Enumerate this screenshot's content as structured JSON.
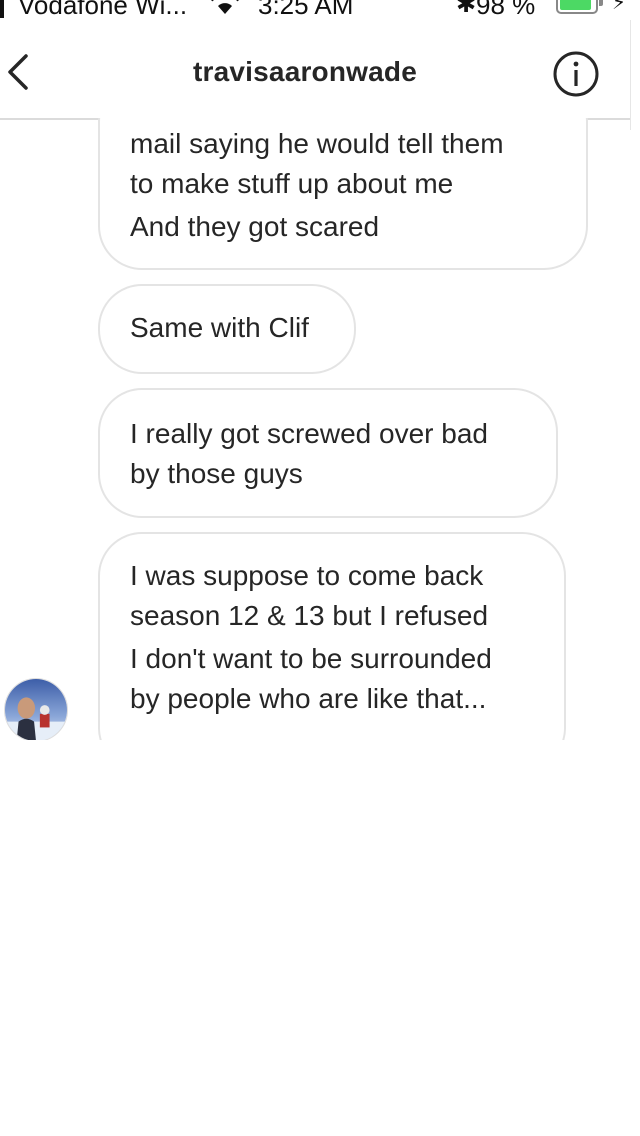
{
  "status_bar": {
    "carrier": "Vodafone Wi...",
    "time": "3:25 AM",
    "battery_percent": "98 %",
    "battery_level": 0.98,
    "battery_color": "#4cd964"
  },
  "header": {
    "title": "travisaaronwade",
    "back_icon": "chevron-left-icon",
    "info_icon": "info-icon"
  },
  "messages": [
    {
      "lines": [
        "mail saying he would tell them",
        "to make stuff up about me",
        "And they got scared"
      ]
    },
    {
      "lines": [
        "Same with Clif"
      ]
    },
    {
      "lines": [
        "I really got screwed over bad",
        "by those guys"
      ]
    },
    {
      "lines": [
        "I was suppose to come back",
        "season 12 & 13 but I refused",
        "I don't want to be surrounded",
        "by people who are like that..."
      ]
    }
  ],
  "colors": {
    "bubble_border": "#e4e4e4",
    "text": "#262626",
    "divider": "#dbdbdb"
  }
}
